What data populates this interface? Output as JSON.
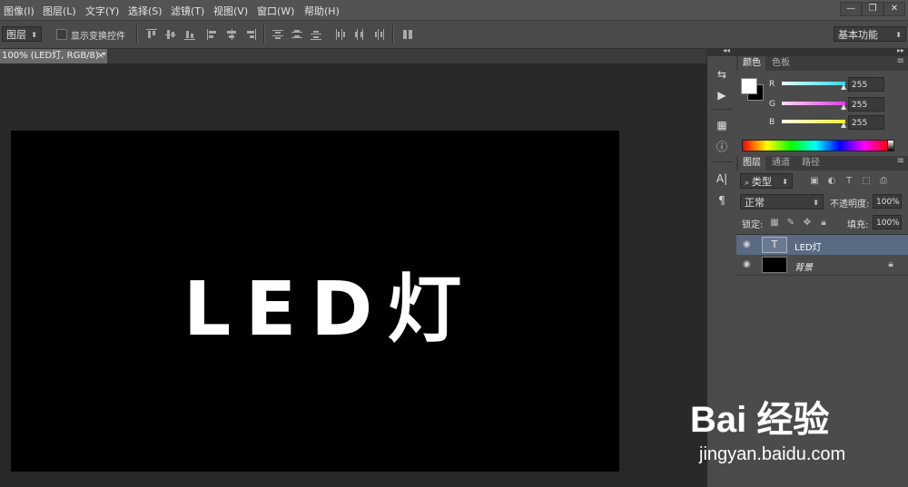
{
  "menu": [
    "图像(I)",
    "图层(L)",
    "文字(Y)",
    "选择(S)",
    "滤镜(T)",
    "视图(V)",
    "窗口(W)",
    "帮助(H)"
  ],
  "window_buttons": [
    "—",
    "❐",
    "✕"
  ],
  "options_bar": {
    "tool_select": "图层",
    "show_transform_label": "显示变换控件",
    "workspace": "基本功能"
  },
  "document_tab": {
    "title": "100% (LED灯, RGB/8) *",
    "close": "×"
  },
  "canvas": {
    "text": "LED灯",
    "background": "#000000",
    "text_color": "#ffffff"
  },
  "color_panel": {
    "tabs": [
      "颜色",
      "色板"
    ],
    "channels": [
      {
        "label": "R",
        "value": "255",
        "color": "#39d6e8"
      },
      {
        "label": "G",
        "value": "255",
        "color": "#e03ee0"
      },
      {
        "label": "B",
        "value": "255",
        "color": "#f0f03a"
      }
    ]
  },
  "layers_panel": {
    "tabs": [
      "图层",
      "通道",
      "路径"
    ],
    "filter_kind": "类型",
    "blend_mode": "正常",
    "opacity_label": "不透明度:",
    "opacity_value": "100%",
    "lock_label": "锁定:",
    "fill_label": "填充:",
    "fill_value": "100%",
    "layers": [
      {
        "name": "LED灯",
        "type": "text",
        "selected": true
      },
      {
        "name": "背景",
        "type": "background",
        "selected": false
      }
    ]
  },
  "watermark": {
    "logo": "Bai 经验",
    "url": "jingyan.baidu.com"
  },
  "colors": {
    "menubar": "#535353",
    "panel": "#4b4b4b",
    "selected_layer": "#5a6a82"
  }
}
